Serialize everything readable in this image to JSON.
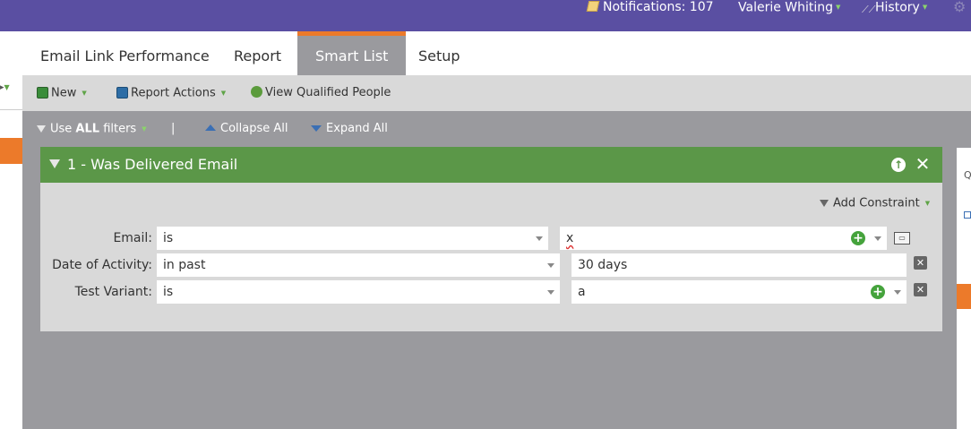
{
  "topbar": {
    "notifications": "Notifications: 107",
    "user": "Valerie Whiting",
    "history": "History"
  },
  "tabs": [
    {
      "label": "Email Link Performance"
    },
    {
      "label": "Report"
    },
    {
      "label": "Smart List",
      "active": true
    },
    {
      "label": "Setup"
    }
  ],
  "toolbar": {
    "new_label": "New",
    "report_actions_label": "Report Actions",
    "view_qualified_label": "View Qualified People"
  },
  "filter_actions": {
    "use_prefix": "Use ",
    "use_all": "ALL",
    "use_suffix": " filters",
    "separator": "|",
    "collapse_all": "Collapse All",
    "expand_all": "Expand All"
  },
  "filter": {
    "title": "1 - Was Delivered Email",
    "add_constraint": "Add Constraint",
    "rows": [
      {
        "label": "Email:",
        "operator": "is",
        "value": "x"
      },
      {
        "label": "Date of Activity:",
        "operator": "in past",
        "value": "30 days"
      },
      {
        "label": "Test Variant:",
        "operator": "is",
        "value": "a"
      }
    ]
  },
  "colors": {
    "topbar": "#5a4fa2",
    "accent_orange": "#ec7a2a",
    "filter_header_green": "#5b9748",
    "canvas_gray": "#9a9a9e"
  },
  "icons": {
    "notifications": "notepad-icon",
    "history": "history-icon",
    "settings": "gear-icon",
    "new": "new-icon",
    "report_actions": "report-icon",
    "view_people": "people-icon",
    "filter": "funnel-icon",
    "collapse": "triangle-up-icon",
    "expand": "triangle-down-icon",
    "move_up": "arrow-up-icon",
    "close": "close-icon",
    "add": "plus-icon",
    "lookup": "lookup-icon",
    "remove": "remove-icon"
  }
}
